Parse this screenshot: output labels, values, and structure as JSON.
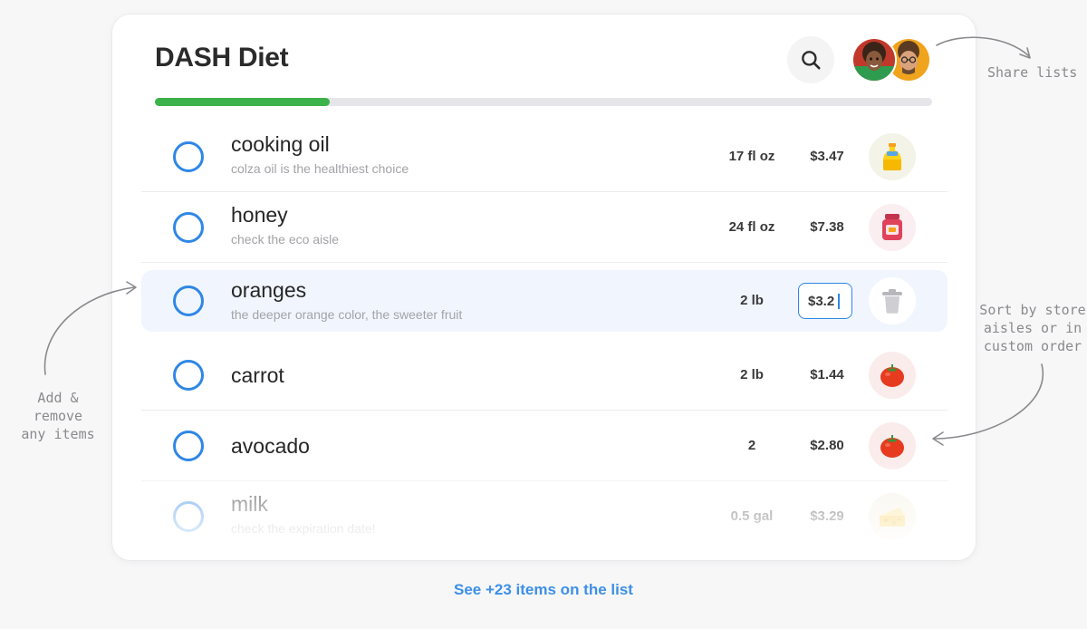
{
  "app": {
    "title": "DASH Diet",
    "progress_fraction": 0.225
  },
  "items": [
    {
      "name": "cooking oil",
      "note": "colza oil is the healthiest choice",
      "qty": "17 fl oz",
      "price": "$3.47",
      "icon": "oil-bottle-icon",
      "icon_bg": "#f3f3e8"
    },
    {
      "name": "honey",
      "note": "check the eco aisle",
      "qty": "24 fl oz",
      "price": "$7.38",
      "icon": "honey-jar-icon",
      "icon_bg": "#fbeef1"
    },
    {
      "name": "oranges",
      "note": "the deeper orange color, the sweeter fruit",
      "qty": "2 lb",
      "price": "$3.2",
      "icon": "trash-icon",
      "icon_bg": "#ffffff"
    },
    {
      "name": "carrot",
      "note": "",
      "qty": "2 lb",
      "price": "$1.44",
      "icon": "tomato-icon",
      "icon_bg": "#fbecec"
    },
    {
      "name": "avocado",
      "note": "",
      "qty": "2",
      "price": "$2.80",
      "icon": "tomato-icon",
      "icon_bg": "#fbecec"
    },
    {
      "name": "milk",
      "note": "check the expiration date!",
      "qty": "0.5 gal",
      "price": "$3.29",
      "icon": "cheese-icon",
      "icon_bg": "#f6f1e4"
    }
  ],
  "footer": {
    "see_more": "See +23 items on the list"
  },
  "annotations": {
    "share": "Share lists",
    "add_remove": [
      "Add &",
      "remove",
      "any items"
    ],
    "sort": [
      "Sort by store",
      "aisles or in",
      "custom order"
    ]
  },
  "colors": {
    "accent_blue": "#2f87e6",
    "progress_green": "#3bb34a",
    "link_blue": "#3d8fe8"
  }
}
